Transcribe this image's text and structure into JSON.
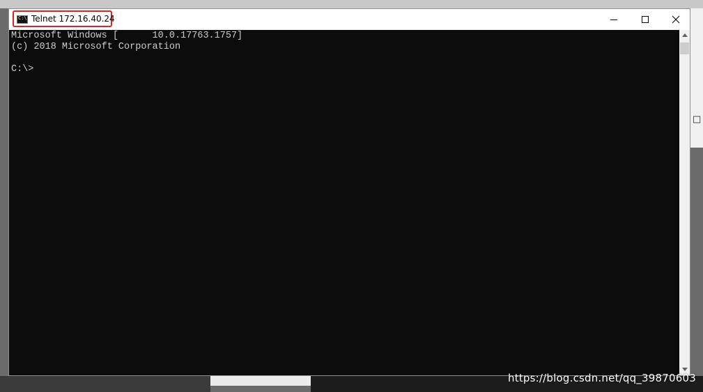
{
  "window": {
    "title": "Telnet 172.16.40.24",
    "icon": "console-icon",
    "icon_glyph": "C:\\",
    "controls": {
      "minimize": "minimize-icon",
      "maximize": "maximize-icon",
      "close": "close-icon"
    }
  },
  "console": {
    "lines": [
      "Microsoft Windows [      10.0.17763.1757]",
      "(c) 2018 Microsoft Corporation",
      "C:\\>"
    ],
    "background": "#0c0c0c",
    "foreground": "#cccccc"
  },
  "watermark": "https://blog.csdn.net/qq_39870603",
  "highlight_color": "#e0231f"
}
